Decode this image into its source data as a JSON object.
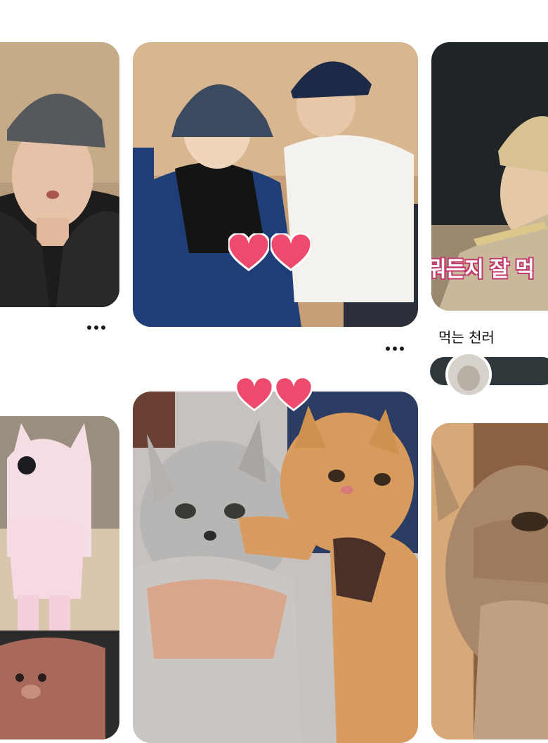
{
  "pins": [
    {
      "id": "pin-1",
      "image": "photo-person-black-cap-black-hoodie"
    },
    {
      "id": "pin-2",
      "image": "photo-two-people-bucket-hat-and-cap",
      "stickers": [
        "heart-icon",
        "heart-icon"
      ]
    },
    {
      "id": "pin-3",
      "image": "photo-person-eating",
      "caption_overlay": "뭐든지 잘 먹",
      "title": "먹는 천러"
    },
    {
      "id": "pin-4",
      "image": "photo-pink-cat-mascot-and-teddy-bear"
    },
    {
      "id": "pin-5",
      "image": "photo-grey-kitten-and-orange-cat",
      "stickers": [
        "heart-icon",
        "heart-icon"
      ]
    },
    {
      "id": "pin-6",
      "image": "photo-tabby-cat-closeup"
    }
  ],
  "more_icon": "more-options-icon",
  "colors": {
    "heart": "#ee4a6e",
    "dots": "#1a1a1a",
    "creator_bar": "#2f373b"
  }
}
